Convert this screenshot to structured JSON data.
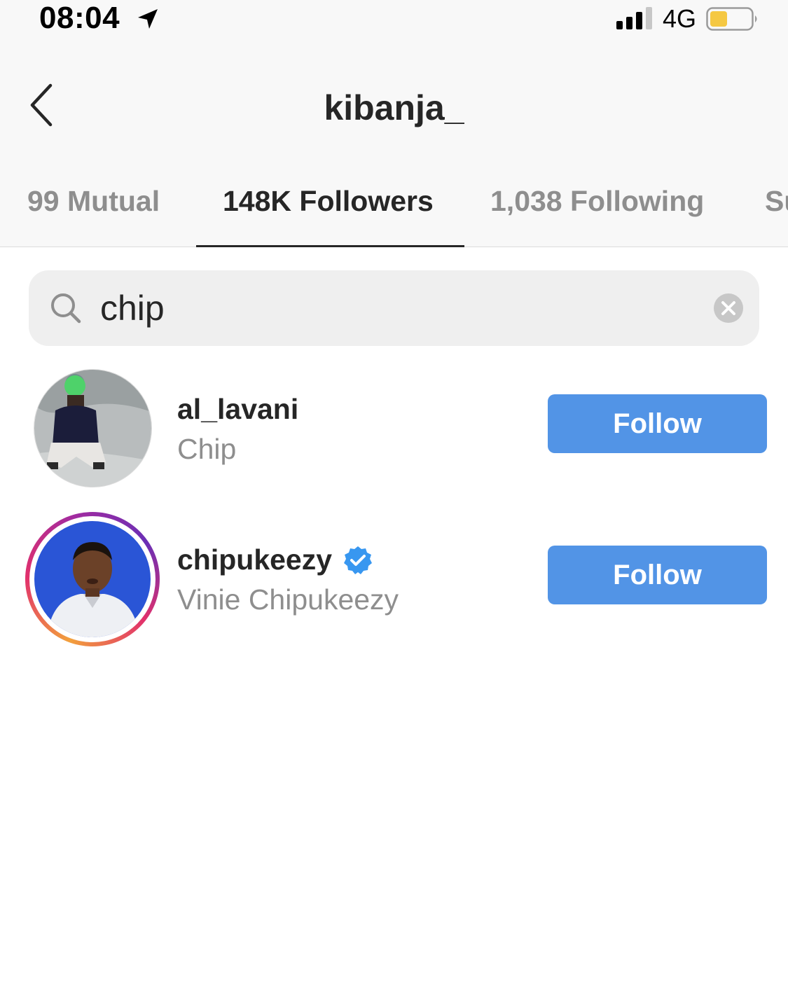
{
  "status_bar": {
    "time": "08:04",
    "network": "4G",
    "icons": [
      "location-arrow-icon",
      "signal-bars-icon",
      "battery-icon"
    ],
    "battery_color": "#f5c842"
  },
  "header": {
    "back_icon": "chevron-left-icon",
    "title": "kibanja_"
  },
  "tabs": [
    {
      "label": "99 Mutual",
      "active": false
    },
    {
      "label": "148K Followers",
      "active": true
    },
    {
      "label": "1,038 Following",
      "active": false
    },
    {
      "label": "Su",
      "active": false
    }
  ],
  "search": {
    "value": "chip",
    "icons": [
      "search-icon",
      "clear-icon"
    ]
  },
  "results": [
    {
      "username": "al_lavani",
      "full_name": "Chip",
      "verified": false,
      "has_story": false,
      "button": "Follow"
    },
    {
      "username": "chipukeezy",
      "full_name": "Vinie Chipukeezy",
      "verified": true,
      "has_story": true,
      "button": "Follow"
    }
  ],
  "colors": {
    "follow_button": "#5294e6",
    "verified_badge": "#3897f0",
    "muted_text": "#8e8e8e",
    "primary_text": "#262626"
  }
}
